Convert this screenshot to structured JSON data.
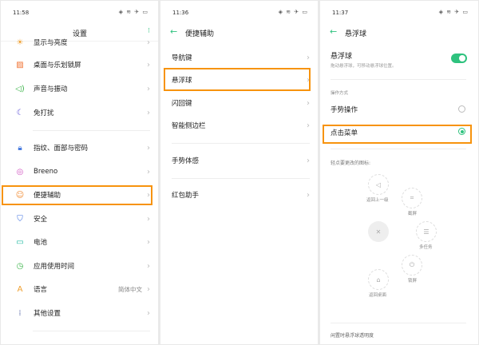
{
  "panel1": {
    "time": "11:58",
    "title": "设置",
    "items": [
      {
        "label": "显示与亮度",
        "icon": "brightness-icon",
        "color": "#f0a030"
      },
      {
        "label": "桌面与乐划锁屏",
        "icon": "wallpaper-icon",
        "color": "#f07030"
      },
      {
        "label": "声音与振动",
        "icon": "speaker-icon",
        "color": "#3cb44a"
      },
      {
        "label": "免打扰",
        "icon": "moon-icon",
        "color": "#5b4fd6"
      },
      {
        "label": "指纹、面部与密码",
        "icon": "lock-icon",
        "color": "#4a7de0"
      },
      {
        "label": "Breeno",
        "icon": "breeno-icon",
        "color": "#d050c0"
      },
      {
        "label": "便捷辅助",
        "icon": "assist-icon",
        "color": "#f08a30"
      },
      {
        "label": "安全",
        "icon": "shield-icon",
        "color": "#3a6ee0"
      },
      {
        "label": "电池",
        "icon": "battery-icon",
        "color": "#20b8a0"
      },
      {
        "label": "应用使用时间",
        "icon": "clock-icon",
        "color": "#3cb44a"
      },
      {
        "label": "语言",
        "icon": "language-icon",
        "color": "#f0a030",
        "value": "简体中文"
      },
      {
        "label": "其他设置",
        "icon": "more-icon",
        "color": "#6a7ab0"
      }
    ]
  },
  "panel2": {
    "time": "11:36",
    "title": "便捷辅助",
    "items": [
      "导航键",
      "悬浮球",
      "闪回键",
      "智能侧边栏",
      "手势体感",
      "红包助手"
    ]
  },
  "panel3": {
    "time": "11:37",
    "title": "悬浮球",
    "toggle_label": "悬浮球",
    "toggle_desc": "拖动悬浮球，可移动悬浮球位置。",
    "toggle_on": true,
    "section": "操作方式",
    "options": [
      "手势操作",
      "点击菜单"
    ],
    "selected": "点击菜单",
    "icons_hint": "轻点要更改的图标:",
    "menu": {
      "back": "返回上一级",
      "screenshot": "截屏",
      "multitask": "多任务",
      "lock": "锁屏",
      "home": "返回桌面"
    },
    "opacity_label": "闲置时悬浮球透明度"
  },
  "accent": "#2ec27e",
  "highlight": "#f7930d"
}
